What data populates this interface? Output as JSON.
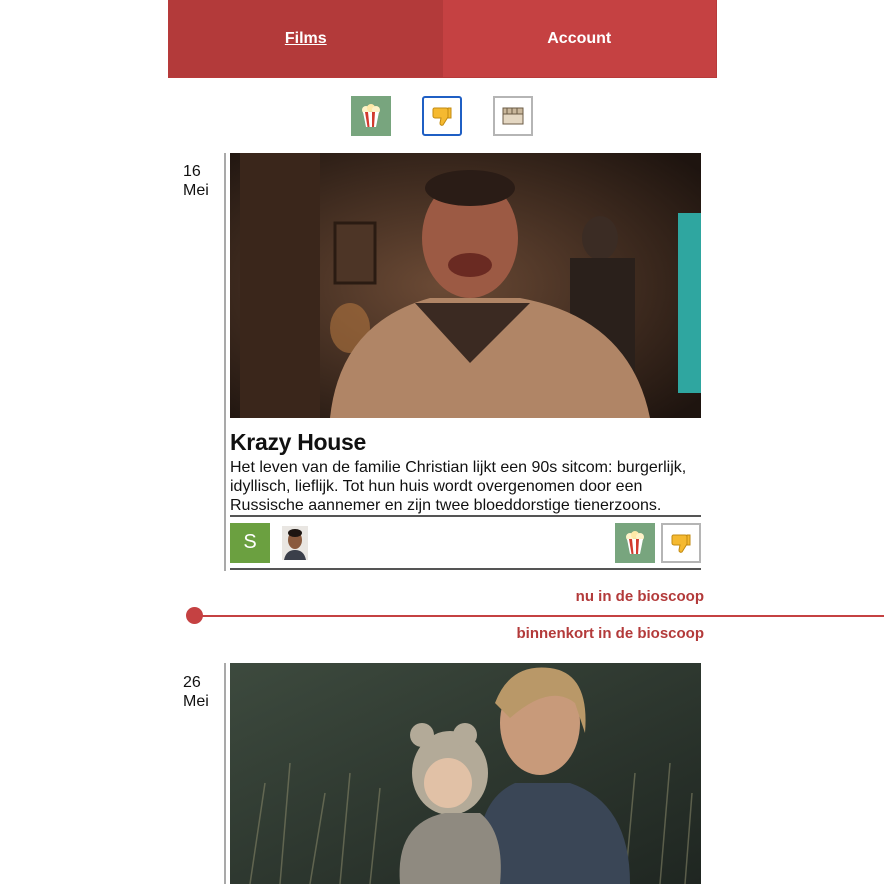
{
  "nav": {
    "films_label": "Films",
    "account_label": "Account"
  },
  "filters": [
    {
      "name": "popcorn-icon",
      "active": true
    },
    {
      "name": "thumbs-down-icon",
      "selected": true
    },
    {
      "name": "film-reel-icon",
      "active": false
    }
  ],
  "timeline": {
    "now_label": "nu in de bioscoop",
    "soon_label": "binnenkort in de bioscoop"
  },
  "films": [
    {
      "date_day": "16",
      "date_month": "Mei",
      "title": "Krazy House",
      "description": "Het leven van de familie Christian lijkt een 90s sitcom: burgerlijk, idyllisch, lieflijk. Tot hun huis wordt overgenomen door een Russische aannemer en zijn twee bloeddorstige tienerzoons. Van…",
      "avatar_initial": "S"
    },
    {
      "date_day": "26",
      "date_month": "Mei"
    }
  ],
  "colors": {
    "brand_red": "#c54142",
    "popcorn_green": "#78a57e",
    "avatar_green": "#6ba040",
    "selected_blue": "#1f5fc4"
  }
}
